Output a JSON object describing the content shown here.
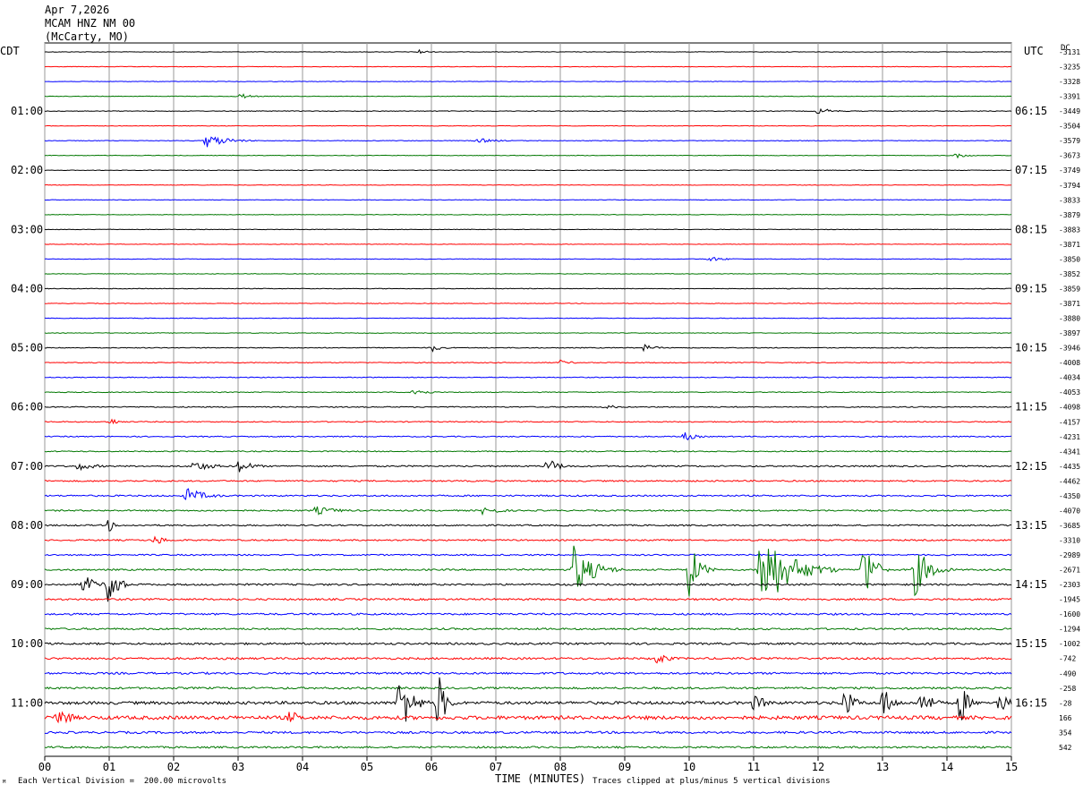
{
  "header": {
    "date": "Apr 7,2026",
    "station": "MCAM HNZ NM 00",
    "location": "(McCarty, MO)"
  },
  "left_timezone": "CDT",
  "right_timezone": "UTC",
  "dc_label": "DC",
  "footer": {
    "mark": "ᴹ",
    "scale_note": "Each Vertical Division =  200.00 microvolts",
    "clip_note": "Traces clipped at plus/minus 5 vertical divisions"
  },
  "chart_data": {
    "type": "seismogram",
    "xlabel": "TIME (MINUTES)",
    "x_ticks": [
      "00",
      "01",
      "02",
      "03",
      "04",
      "05",
      "06",
      "07",
      "08",
      "09",
      "10",
      "11",
      "12",
      "13",
      "14",
      "15"
    ],
    "xlim": [
      0,
      15
    ],
    "trace_colors": [
      "#000000",
      "#ff0000",
      "#0000ff",
      "#007700"
    ],
    "left_hour_labels": [
      {
        "row": 4,
        "text": "01:00"
      },
      {
        "row": 8,
        "text": "02:00"
      },
      {
        "row": 12,
        "text": "03:00"
      },
      {
        "row": 16,
        "text": "04:00"
      },
      {
        "row": 20,
        "text": "05:00"
      },
      {
        "row": 24,
        "text": "06:00"
      },
      {
        "row": 28,
        "text": "07:00"
      },
      {
        "row": 32,
        "text": "08:00"
      },
      {
        "row": 36,
        "text": "09:00"
      },
      {
        "row": 40,
        "text": "10:00"
      },
      {
        "row": 44,
        "text": "11:00"
      }
    ],
    "right_hour_labels": [
      {
        "row": 4,
        "text": "06:15"
      },
      {
        "row": 8,
        "text": "07:15"
      },
      {
        "row": 12,
        "text": "08:15"
      },
      {
        "row": 16,
        "text": "09:15"
      },
      {
        "row": 20,
        "text": "10:15"
      },
      {
        "row": 24,
        "text": "11:15"
      },
      {
        "row": 28,
        "text": "12:15"
      },
      {
        "row": 32,
        "text": "13:15"
      },
      {
        "row": 36,
        "text": "14:15"
      },
      {
        "row": 40,
        "text": "15:15"
      },
      {
        "row": 44,
        "text": "16:15"
      }
    ],
    "dc_offsets": [
      "-3131",
      "-3235",
      "-3328",
      "-3391",
      "-3449",
      "-3504",
      "-3579",
      "-3673",
      "-3749",
      "-3794",
      "-3833",
      "-3879",
      "-3883",
      "-3871",
      "-3850",
      "-3852",
      "-3859",
      "-3871",
      "-3880",
      "-3897",
      "-3946",
      "-4008",
      "-4034",
      "-4053",
      "-4098",
      "-4157",
      "-4231",
      "-4341",
      "-4435",
      "-4462",
      "-4350",
      "-4070",
      "-3685",
      "-3310",
      "-2989",
      "-2671",
      "-2303",
      "-1945",
      "-1600",
      "-1294",
      "-1002",
      "-742",
      "-490",
      "-258",
      "-28",
      "166",
      "354",
      "542"
    ],
    "noise_levels": [
      0.3,
      0.3,
      0.3,
      0.3,
      0.35,
      0.3,
      0.35,
      0.3,
      0.3,
      0.3,
      0.3,
      0.3,
      0.3,
      0.3,
      0.3,
      0.3,
      0.35,
      0.35,
      0.35,
      0.35,
      0.45,
      0.45,
      0.45,
      0.45,
      0.55,
      0.55,
      0.6,
      0.6,
      0.8,
      0.8,
      0.85,
      0.8,
      0.8,
      0.8,
      0.8,
      0.9,
      1.0,
      1.0,
      1.0,
      1.0,
      1.1,
      1.1,
      1.1,
      1.1,
      1.6,
      2.0,
      1.2,
      1.0
    ],
    "events": [
      {
        "row": 0,
        "min": 5.8,
        "dur": 0.4,
        "amp": 3
      },
      {
        "row": 3,
        "min": 3.0,
        "dur": 0.5,
        "amp": 4
      },
      {
        "row": 4,
        "min": 12.0,
        "dur": 0.6,
        "amp": 4
      },
      {
        "row": 6,
        "min": 2.5,
        "dur": 0.9,
        "amp": 8
      },
      {
        "row": 6,
        "min": 6.7,
        "dur": 0.8,
        "amp": 3
      },
      {
        "row": 7,
        "min": 14.1,
        "dur": 0.5,
        "amp": 4
      },
      {
        "row": 14,
        "min": 10.3,
        "dur": 0.7,
        "amp": 3
      },
      {
        "row": 20,
        "min": 6.0,
        "dur": 0.4,
        "amp": 5
      },
      {
        "row": 20,
        "min": 9.3,
        "dur": 0.5,
        "amp": 4
      },
      {
        "row": 21,
        "min": 8.0,
        "dur": 0.5,
        "amp": 3
      },
      {
        "row": 23,
        "min": 5.7,
        "dur": 0.6,
        "amp": 5
      },
      {
        "row": 24,
        "min": 8.7,
        "dur": 0.5,
        "amp": 3
      },
      {
        "row": 25,
        "min": 1.0,
        "dur": 0.4,
        "amp": 5
      },
      {
        "row": 26,
        "min": 9.9,
        "dur": 0.5,
        "amp": 6
      },
      {
        "row": 28,
        "min": 0.5,
        "dur": 0.8,
        "amp": 5
      },
      {
        "row": 28,
        "min": 2.3,
        "dur": 0.9,
        "amp": 6
      },
      {
        "row": 28,
        "min": 3.0,
        "dur": 0.6,
        "amp": 8
      },
      {
        "row": 28,
        "min": 7.8,
        "dur": 0.5,
        "amp": 10
      },
      {
        "row": 30,
        "min": 2.2,
        "dur": 0.8,
        "amp": 9
      },
      {
        "row": 31,
        "min": 4.2,
        "dur": 1.0,
        "amp": 5
      },
      {
        "row": 31,
        "min": 6.8,
        "dur": 0.8,
        "amp": 5
      },
      {
        "row": 32,
        "min": 1.0,
        "dur": 0.15,
        "amp": 10
      },
      {
        "row": 33,
        "min": 1.7,
        "dur": 0.5,
        "amp": 6
      },
      {
        "row": 35,
        "min": 8.2,
        "dur": 0.8,
        "amp": 30
      },
      {
        "row": 35,
        "min": 10.0,
        "dur": 0.4,
        "amp": 35
      },
      {
        "row": 35,
        "min": 11.1,
        "dur": 1.2,
        "amp": 50
      },
      {
        "row": 35,
        "min": 12.7,
        "dur": 0.4,
        "amp": 45
      },
      {
        "row": 35,
        "min": 13.5,
        "dur": 0.6,
        "amp": 30
      },
      {
        "row": 36,
        "min": 0.6,
        "dur": 0.5,
        "amp": 12
      },
      {
        "row": 36,
        "min": 1.0,
        "dur": 0.3,
        "amp": 40
      },
      {
        "row": 41,
        "min": 9.5,
        "dur": 0.5,
        "amp": 8
      },
      {
        "row": 44,
        "min": 5.5,
        "dur": 0.5,
        "amp": 40
      },
      {
        "row": 44,
        "min": 6.1,
        "dur": 0.3,
        "amp": 40
      },
      {
        "row": 44,
        "min": 11.0,
        "dur": 0.6,
        "amp": 10
      },
      {
        "row": 44,
        "min": 12.4,
        "dur": 0.4,
        "amp": 20
      },
      {
        "row": 44,
        "min": 13.0,
        "dur": 0.4,
        "amp": 20
      },
      {
        "row": 44,
        "min": 13.6,
        "dur": 0.4,
        "amp": 20
      },
      {
        "row": 44,
        "min": 14.2,
        "dur": 0.3,
        "amp": 30
      },
      {
        "row": 44,
        "min": 14.8,
        "dur": 0.4,
        "amp": 15
      },
      {
        "row": 45,
        "min": 0.2,
        "dur": 0.5,
        "amp": 15
      },
      {
        "row": 45,
        "min": 3.8,
        "dur": 0.4,
        "amp": 10
      }
    ]
  }
}
